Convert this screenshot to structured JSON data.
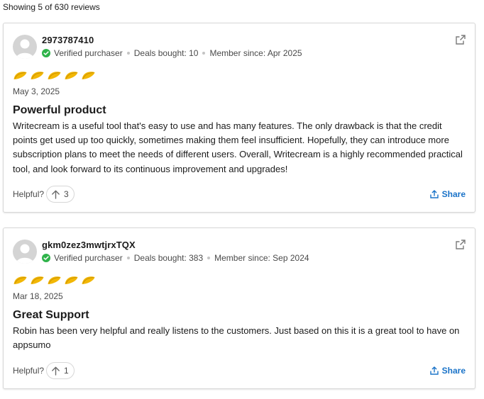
{
  "summary": "Showing 5 of 630 reviews",
  "colors": {
    "verified": "#2fb34a",
    "taco": "#f2b705",
    "link": "#1a73c8"
  },
  "icons": {
    "avatar": "user-avatar-icon",
    "verified": "check-circle-icon",
    "external": "external-link-icon",
    "rating": "taco-icon",
    "upvote": "arrow-up-icon",
    "share": "share-icon"
  },
  "reviews": [
    {
      "username": "2973787410",
      "verified": "Verified purchaser",
      "deals": "Deals bought: 10",
      "member": "Member since: Apr 2025",
      "rating": 5,
      "date": "May 3, 2025",
      "title": "Powerful product",
      "body": "Writecream is a useful tool that's easy to use and has many features. The only drawback is that the credit points get used up too quickly, sometimes making them feel insufficient. Hopefully, they can introduce more subscription plans to meet the needs of different users. Overall, Writecream is a highly recommended practical tool, and look forward to its continuous improvement and upgrades!",
      "helpful_label": "Helpful?",
      "helpful_count": "3",
      "share_label": "Share"
    },
    {
      "username": "gkm0zez3mwtjrxTQX",
      "verified": "Verified purchaser",
      "deals": "Deals bought: 383",
      "member": "Member since: Sep 2024",
      "rating": 5,
      "date": "Mar 18, 2025",
      "title": "Great Support",
      "body": "Robin has been very helpful and really listens to the customers. Just based on this it is a great tool to have on appsumo",
      "helpful_label": "Helpful?",
      "helpful_count": "1",
      "share_label": "Share"
    }
  ]
}
